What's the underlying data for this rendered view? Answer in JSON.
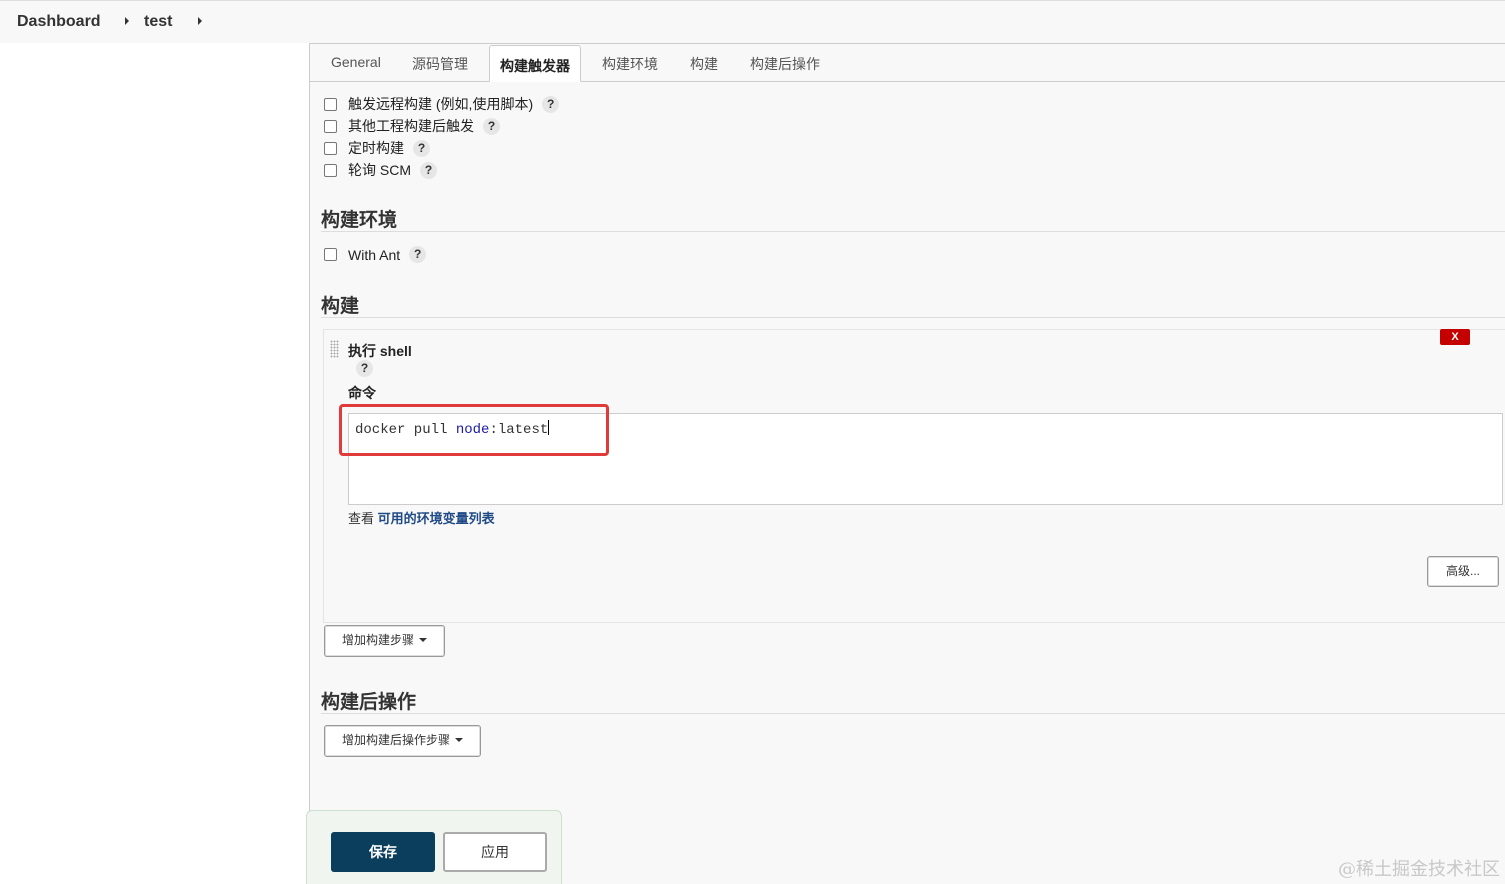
{
  "breadcrumb": {
    "items": [
      "Dashboard",
      "test"
    ]
  },
  "tabs": [
    {
      "label": "General",
      "active": false
    },
    {
      "label": "源码管理",
      "active": false
    },
    {
      "label": "构建触发器",
      "active": true
    },
    {
      "label": "构建环境",
      "active": false
    },
    {
      "label": "构建",
      "active": false
    },
    {
      "label": "构建后操作",
      "active": false
    }
  ],
  "triggers": [
    {
      "label": "触发远程构建 (例如,使用脚本)",
      "checked": false
    },
    {
      "label": "其他工程构建后触发",
      "checked": false
    },
    {
      "label": "定时构建",
      "checked": false
    },
    {
      "label": "轮询 SCM",
      "checked": false
    }
  ],
  "help_glyph": "?",
  "build_env": {
    "title": "构建环境",
    "options": [
      {
        "label": "With Ant",
        "checked": false
      }
    ]
  },
  "build": {
    "title": "构建",
    "step": {
      "title": "执行 shell",
      "delete_label": "X",
      "command_label": "命令",
      "command_parts": [
        "docker pull ",
        "node",
        ":latest"
      ],
      "env_prefix": "查看",
      "env_link": "可用的环境变量列表",
      "advanced_label": "高级..."
    },
    "add_step_label": "增加构建步骤"
  },
  "post_build": {
    "title": "构建后操作",
    "add_step_label": "增加构建后操作步骤"
  },
  "footer": {
    "save_label": "保存",
    "apply_label": "应用"
  },
  "watermark": "@稀土掘金技术社区",
  "colors": {
    "save": "#0b3d5c",
    "delete": "#c40000",
    "highlight": "#e03b3b",
    "link": "#204a87"
  }
}
